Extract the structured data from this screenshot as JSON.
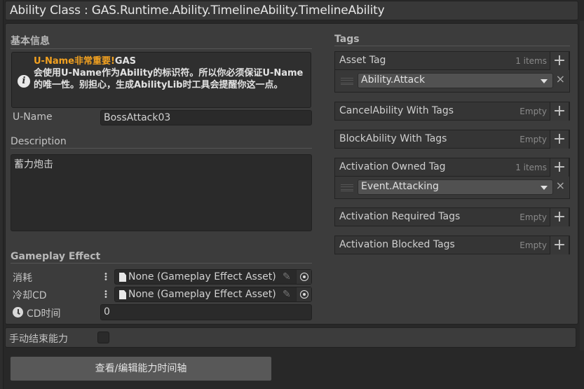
{
  "header": {
    "title": "Ability Class : GAS.Runtime.Ability.TimelineAbility.TimelineAbility"
  },
  "basic_info": {
    "section_title": "基本信息",
    "helpbox": {
      "icon": "info-icon",
      "warning_text": "U-Name非常重要!",
      "line1_rest": "GAS",
      "body": "会使用U-Name作为Ability的标识符。所以你必须保证U-Name的唯一性。别担心，生成AbilityLib时工具会提醒你这一点。"
    },
    "uname": {
      "label": "U-Name",
      "value": "BossAttack03"
    },
    "description": {
      "label": "Description",
      "value": "蓄力炮击"
    }
  },
  "gameplay_effect": {
    "section_title": "Gameplay Effect",
    "fields": [
      {
        "label": "消耗",
        "value": "None (Gameplay Effect Asset)"
      },
      {
        "label": "冷却CD",
        "value": "None (Gameplay Effect Asset)"
      }
    ],
    "cd_time": {
      "label": "CD时间",
      "value": "0",
      "icon": "clock-icon"
    }
  },
  "manual_end": {
    "label": "手动结束能力",
    "checked": false
  },
  "timeline_button": {
    "label": "查看/编辑能力时间轴"
  },
  "tags": {
    "section_title": "Tags",
    "lists": [
      {
        "title": "Asset Tag",
        "count": "1 items",
        "items": [
          "Ability.Attack"
        ]
      },
      {
        "title": "CancelAbility With Tags",
        "count": "Empty",
        "items": []
      },
      {
        "title": "BlockAbility With Tags",
        "count": "Empty",
        "items": []
      },
      {
        "title": "Activation Owned Tag",
        "count": "1 items",
        "items": [
          "Event.Attacking"
        ]
      },
      {
        "title": "Activation Required Tags",
        "count": "Empty",
        "items": []
      },
      {
        "title": "Activation Blocked Tags",
        "count": "Empty",
        "items": []
      }
    ],
    "add_symbol": "+",
    "remove_symbol": "×"
  }
}
